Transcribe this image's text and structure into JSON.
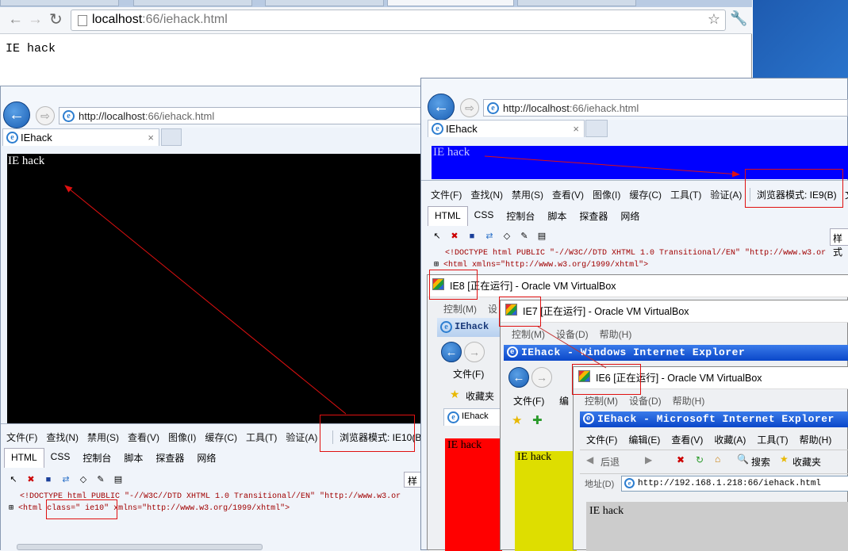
{
  "chrome": {
    "url_host": "localhost",
    "url_rest": ":66/iehack.html",
    "body_text": "IE hack"
  },
  "ie10": {
    "url_host": "http://localhost",
    "url_rest": ":66/iehack.html",
    "tab_title": "IEhack",
    "page_text": "IE hack",
    "menu": [
      "文件(F)",
      "查找(N)",
      "禁用(S)",
      "查看(V)",
      "图像(I)",
      "缓存(C)",
      "工具(T)",
      "验证(A)"
    ],
    "browser_mode": "浏览器模式: IE10(B)",
    "devtabs": [
      "HTML",
      "CSS",
      "控制台",
      "脚本",
      "探查器",
      "网络"
    ],
    "side_label": "样",
    "code_line1": "<!DOCTYPE html PUBLIC \"-//W3C//DTD XHTML 1.0 Transitional//EN\" \"http://www.w3.or",
    "code_line2_a": "<html ",
    "code_line2_b": "class=\" ie10\"",
    "code_line2_c": " xmlns=\"http://www.w3.org/1999/xhtml\">",
    "page_bg": "#000000",
    "page_fg": "#ffffff"
  },
  "ie9": {
    "url_host": "http://localhost",
    "url_rest": ":66/iehack.html",
    "tab_title": "IEhack",
    "page_text": "IE hack",
    "menu": [
      "文件(F)",
      "查找(N)",
      "禁用(S)",
      "查看(V)",
      "图像(I)",
      "缓存(C)",
      "工具(T)",
      "验证(A)"
    ],
    "browser_mode": "浏览器模式: IE9(B)",
    "menu_overflow": "文",
    "devtabs": [
      "HTML",
      "CSS",
      "控制台",
      "脚本",
      "探查器",
      "网络"
    ],
    "side_label": "样式",
    "code_line1": "<!DOCTYPE html PUBLIC \"-//W3C//DTD XHTML 1.0 Transitional//EN\" \"http://www.w3.or",
    "code_line2": "<html xmlns=\"http://www.w3.org/1999/xhtml\">",
    "page_bg": "#0000ff"
  },
  "ie8": {
    "vbox_title": "IE8 [正在运行] - Oracle VM VirtualBox",
    "vbox_menu": [
      "控制(M)",
      "设"
    ],
    "ie_title": "IEhack",
    "file_menu": "文件(F)",
    "favorites": "收藏夹",
    "tab_title": "IEhack",
    "page_text": "IE hack",
    "page_bg": "#ff0000"
  },
  "ie7": {
    "vbox_title": "IE7 [正在运行] - Oracle VM VirtualBox",
    "vbox_menu": [
      "控制(M)",
      "设备(D)",
      "帮助(H)"
    ],
    "ie_title": "IEhack - Windows Internet Explorer",
    "file_menu": "文件(F)",
    "edit_menu": "编",
    "page_text": "IE hack",
    "page_bg": "#dede00"
  },
  "ie6": {
    "vbox_title": "IE6 [正在运行] - Oracle VM VirtualBox",
    "vbox_menu": [
      "控制(M)",
      "设备(D)",
      "帮助(H)"
    ],
    "ie_title": "IEhack - Microsoft Internet Explorer",
    "menu": [
      "文件(F)",
      "编辑(E)",
      "查看(V)",
      "收藏(A)",
      "工具(T)",
      "帮助(H)"
    ],
    "back": "后退",
    "search": "搜索",
    "favorites": "收藏夹",
    "address_label": "地址(D)",
    "address": "http://192.168.1.218:66/iehack.html",
    "page_text": "IE hack",
    "page_bg": "#cccccc"
  }
}
